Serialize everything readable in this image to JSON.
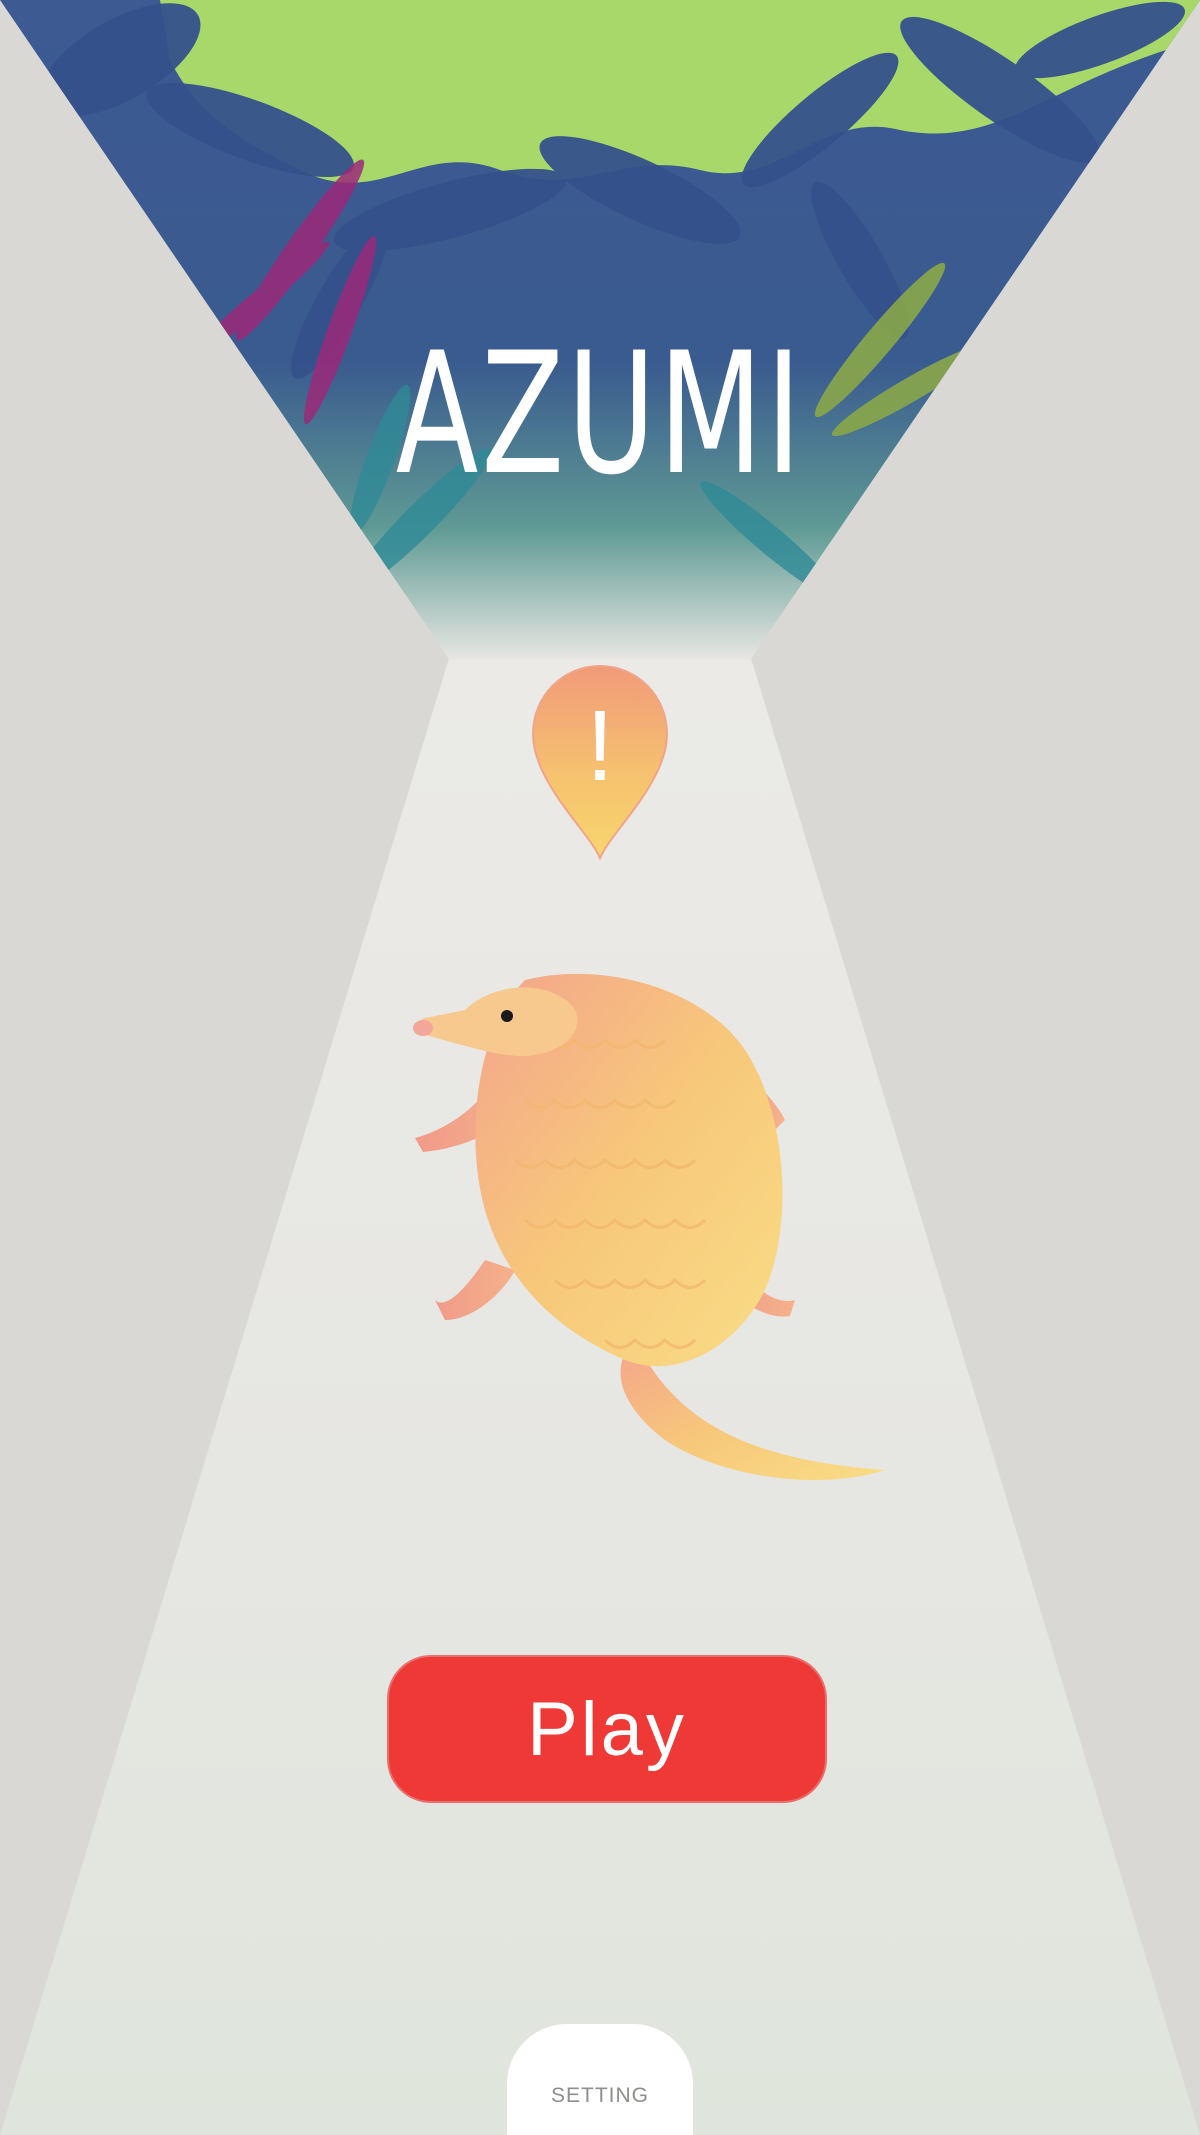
{
  "game": {
    "title": "AZUMI"
  },
  "alert": {
    "icon": "exclamation-pin-icon",
    "glyph": "!"
  },
  "character": {
    "name": "pangolin-illustration"
  },
  "buttons": {
    "play_label": "Play",
    "setting_label": "SETTING"
  },
  "colors": {
    "play_button": "#ee3937",
    "sky": "#a8d86a",
    "jungle_blue": "#3d5a93",
    "light_beam": "#e8e7e3",
    "side_panels": "#d9d8d5"
  }
}
